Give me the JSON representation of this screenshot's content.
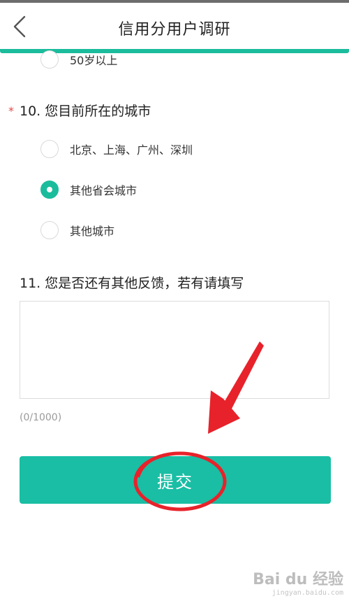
{
  "header": {
    "title": "信用分用户调研",
    "back_icon": "chevron-left-icon"
  },
  "colors": {
    "accent": "#1abc9c",
    "button": "#19bea4",
    "required_star": "#e34a4a",
    "annotation": "#e8222a"
  },
  "previous_question": {
    "last_option": "50岁以上"
  },
  "q10": {
    "required_mark": "*",
    "label": "10. 您目前所在的城市",
    "options": [
      {
        "label": "北京、上海、广州、深圳",
        "selected": false
      },
      {
        "label": "其他省会城市",
        "selected": true
      },
      {
        "label": "其他城市",
        "selected": false
      }
    ]
  },
  "q11": {
    "label": "11. 您是否还有其他反馈，若有请填写",
    "value": "",
    "counter": "(0/1000)"
  },
  "submit": {
    "label": "提交"
  },
  "watermark": {
    "brand": "Bai du 经验",
    "url": "jingyan.baidu.com"
  }
}
